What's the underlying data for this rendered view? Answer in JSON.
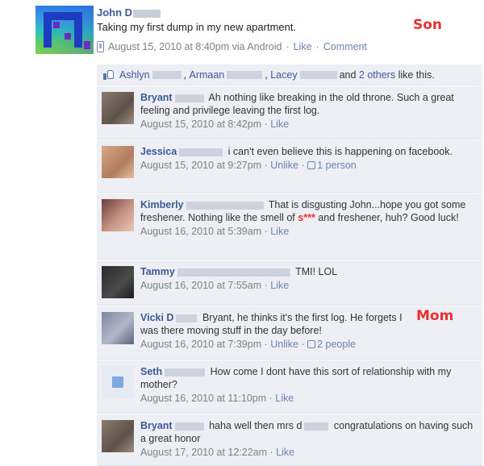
{
  "post": {
    "author": "John D",
    "text": "Taking my first dump in my new apartment.",
    "timestamp": "August 15, 2010 at 8:40pm via Android",
    "like_label": "Like",
    "comment_label": "Comment",
    "separator": "·"
  },
  "annotations": {
    "son": "Son",
    "mom": "Mom"
  },
  "likes": {
    "names": [
      "Ashlyn",
      "Armaan",
      "Lacey"
    ],
    "others": "2 others",
    "and": "and",
    "suffix": "like this."
  },
  "comments": [
    {
      "name": "Bryant",
      "text": "Ah nothing like breaking in the old throne. Such a great feeling and privilege leaving the first log.",
      "time": "August 15, 2010 at 8:42pm",
      "action": "Like",
      "count": ""
    },
    {
      "name": "Jessica",
      "text": "i can't even believe this is happening on facebook.",
      "time": "August 15, 2010 at 9:27pm",
      "action": "Unlike",
      "count": "1 person"
    },
    {
      "name": "Kimberly",
      "text_a": "That is disgusting John...hope you got some freshener. Nothing like the smell of",
      "censored": "s***",
      "text_b": "and freshener, huh? Good luck!",
      "time": "August 16, 2010 at 5:39am",
      "action": "Like",
      "count": ""
    },
    {
      "name": "Tammy",
      "text": "TMI! LOL",
      "time": "August 16, 2010 at 7:55am",
      "action": "Like",
      "count": ""
    },
    {
      "name": "Vicki D",
      "text": "Bryant, he thinks it's the first log. He forgets I was there moving stuff in the day before!",
      "time": "August 16, 2010 at 7:39pm",
      "action": "Unlike",
      "count": "2 people"
    },
    {
      "name": "Seth",
      "text": "How come I dont have this sort of relationship with my mother?",
      "time": "August 16, 2010 at 11:10pm",
      "action": "Like",
      "count": ""
    },
    {
      "name": "Bryant",
      "text_a": "haha well then mrs d",
      "text_b": "congratulations on having such a great honor",
      "time": "August 17, 2010 at 12:22am",
      "action": "Like",
      "count": ""
    }
  ],
  "colors": {
    "link": "#3b5998",
    "annotation": "#e8312f",
    "comment_bg": "#edeff4"
  }
}
